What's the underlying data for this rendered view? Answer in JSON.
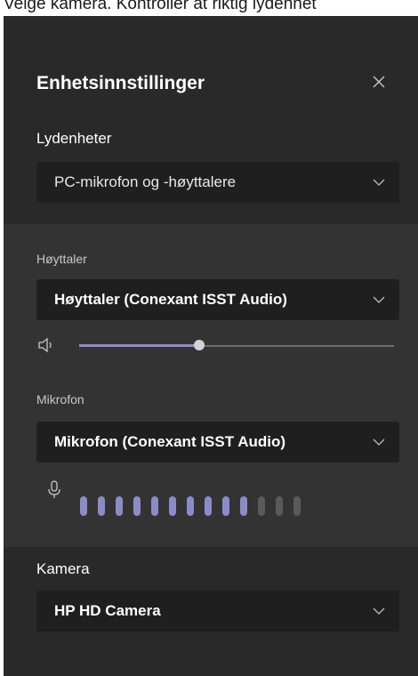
{
  "caption": "Velge kamera. Kontroller at riktig lydenhet",
  "panel": {
    "title": "Enhetsinnstillinger",
    "close_glyph": "✕"
  },
  "audio_devices": {
    "label": "Lydenheter",
    "selected": "PC-mikrofon og -høyttalere"
  },
  "speaker": {
    "label": "Høyttaler",
    "selected": "Høyttaler (Conexant ISST Audio)",
    "volume_fraction": 0.38
  },
  "microphone": {
    "label": "Mikrofon",
    "selected": "Mikrofon (Conexant ISST Audio)",
    "level_bars_total": 13,
    "level_bars_active": 10
  },
  "camera": {
    "label": "Kamera",
    "selected": "HP HD Camera"
  },
  "colors": {
    "panel_bg": "#292929",
    "audio_section_bg": "#333333",
    "dropdown_bg": "#1f1f1f",
    "accent": "#8b8cc7",
    "inactive_bar": "#5a5a5a"
  },
  "icons": {
    "close": "close-icon",
    "chevron": "chevron-down-icon",
    "speaker": "speaker-icon",
    "mic": "microphone-icon"
  }
}
